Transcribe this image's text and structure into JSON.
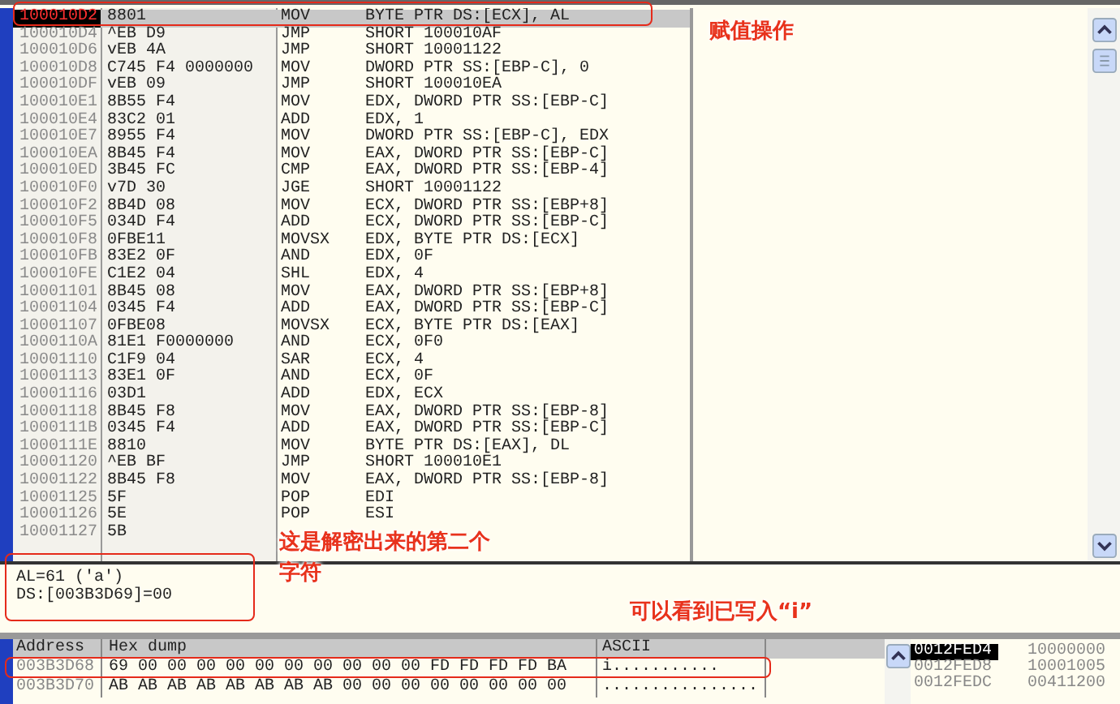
{
  "disassembly": {
    "rows": [
      {
        "address": "100010D2",
        "hex": "8801",
        "mnemonic": "MOV",
        "operand": "BYTE PTR DS:[ECX], AL",
        "selected": true
      },
      {
        "address": "100010D4",
        "hex": "^EB D9",
        "mnemonic": "JMP",
        "operand": "SHORT 100010AF",
        "selected": false
      },
      {
        "address": "100010D6",
        "hex": "vEB 4A",
        "mnemonic": "JMP",
        "operand": "SHORT 10001122",
        "selected": false
      },
      {
        "address": "100010D8",
        "hex": "C745 F4 0000000",
        "mnemonic": "MOV",
        "operand": "DWORD PTR SS:[EBP-C], 0",
        "selected": false
      },
      {
        "address": "100010DF",
        "hex": "vEB 09",
        "mnemonic": "JMP",
        "operand": "SHORT 100010EA",
        "selected": false
      },
      {
        "address": "100010E1",
        "hex": "8B55 F4",
        "mnemonic": "MOV",
        "operand": "EDX, DWORD PTR SS:[EBP-C]",
        "selected": false
      },
      {
        "address": "100010E4",
        "hex": "83C2 01",
        "mnemonic": "ADD",
        "operand": "EDX, 1",
        "selected": false
      },
      {
        "address": "100010E7",
        "hex": "8955 F4",
        "mnemonic": "MOV",
        "operand": "DWORD PTR SS:[EBP-C], EDX",
        "selected": false
      },
      {
        "address": "100010EA",
        "hex": "8B45 F4",
        "mnemonic": "MOV",
        "operand": "EAX, DWORD PTR SS:[EBP-C]",
        "selected": false
      },
      {
        "address": "100010ED",
        "hex": "3B45 FC",
        "mnemonic": "CMP",
        "operand": "EAX, DWORD PTR SS:[EBP-4]",
        "selected": false
      },
      {
        "address": "100010F0",
        "hex": "v7D 30",
        "mnemonic": "JGE",
        "operand": "SHORT 10001122",
        "selected": false
      },
      {
        "address": "100010F2",
        "hex": "8B4D 08",
        "mnemonic": "MOV",
        "operand": "ECX, DWORD PTR SS:[EBP+8]",
        "selected": false
      },
      {
        "address": "100010F5",
        "hex": "034D F4",
        "mnemonic": "ADD",
        "operand": "ECX, DWORD PTR SS:[EBP-C]",
        "selected": false
      },
      {
        "address": "100010F8",
        "hex": "0FBE11",
        "mnemonic": "MOVSX",
        "operand": "EDX, BYTE PTR DS:[ECX]",
        "selected": false
      },
      {
        "address": "100010FB",
        "hex": "83E2 0F",
        "mnemonic": "AND",
        "operand": "EDX, 0F",
        "selected": false
      },
      {
        "address": "100010FE",
        "hex": "C1E2 04",
        "mnemonic": "SHL",
        "operand": "EDX, 4",
        "selected": false
      },
      {
        "address": "10001101",
        "hex": "8B45 08",
        "mnemonic": "MOV",
        "operand": "EAX, DWORD PTR SS:[EBP+8]",
        "selected": false
      },
      {
        "address": "10001104",
        "hex": "0345 F4",
        "mnemonic": "ADD",
        "operand": "EAX, DWORD PTR SS:[EBP-C]",
        "selected": false
      },
      {
        "address": "10001107",
        "hex": "0FBE08",
        "mnemonic": "MOVSX",
        "operand": "ECX, BYTE PTR DS:[EAX]",
        "selected": false
      },
      {
        "address": "1000110A",
        "hex": "81E1 F0000000",
        "mnemonic": "AND",
        "operand": "ECX, 0F0",
        "selected": false
      },
      {
        "address": "10001110",
        "hex": "C1F9 04",
        "mnemonic": "SAR",
        "operand": "ECX, 4",
        "selected": false
      },
      {
        "address": "10001113",
        "hex": "83E1 0F",
        "mnemonic": "AND",
        "operand": "ECX, 0F",
        "selected": false
      },
      {
        "address": "10001116",
        "hex": "03D1",
        "mnemonic": "ADD",
        "operand": "EDX, ECX",
        "selected": false
      },
      {
        "address": "10001118",
        "hex": "8B45 F8",
        "mnemonic": "MOV",
        "operand": "EAX, DWORD PTR SS:[EBP-8]",
        "selected": false
      },
      {
        "address": "1000111B",
        "hex": "0345 F4",
        "mnemonic": "ADD",
        "operand": "EAX, DWORD PTR SS:[EBP-C]",
        "selected": false
      },
      {
        "address": "1000111E",
        "hex": "8810",
        "mnemonic": "MOV",
        "operand": "BYTE PTR DS:[EAX], DL",
        "selected": false
      },
      {
        "address": "10001120",
        "hex": "^EB BF",
        "mnemonic": "JMP",
        "operand": "SHORT 100010E1",
        "selected": false
      },
      {
        "address": "10001122",
        "hex": "8B45 F8",
        "mnemonic": "MOV",
        "operand": "EAX, DWORD PTR SS:[EBP-8]",
        "selected": false
      },
      {
        "address": "10001125",
        "hex": "5F",
        "mnemonic": "POP",
        "operand": "EDI",
        "selected": false
      },
      {
        "address": "10001126",
        "hex": "5E",
        "mnemonic": "POP",
        "operand": "ESI",
        "selected": false
      },
      {
        "address": "10001127",
        "hex": "5B",
        "selected": false
      }
    ]
  },
  "info_pane": {
    "lines": [
      "AL=61 ('a')",
      "DS:[003B3D69]=00"
    ]
  },
  "dump": {
    "columns": [
      "Address",
      "Hex dump",
      "ASCII"
    ],
    "rows": [
      {
        "address": "003B3D68",
        "hex": "69 00 00 00 00 00 00 00 00 00 00 FD FD FD FD BA",
        "ascii": "i..........."
      },
      {
        "address": "003B3D70",
        "hex": "AB AB AB AB AB AB AB AB 00 00 00 00 00 00 00 00",
        "ascii": "................"
      }
    ]
  },
  "stack": {
    "rows": [
      {
        "address": "0012FED4",
        "value": "10000000",
        "selected": true
      },
      {
        "address": "0012FED8",
        "value": "10001005",
        "selected": false
      },
      {
        "address": "0012FEDC",
        "value": "00411200",
        "selected": false
      }
    ]
  },
  "annotations": {
    "assign_note": "赋值操作",
    "decrypt_note": "这是解密出来的第二个字符",
    "write_note": "可以看到已写入“i”"
  }
}
